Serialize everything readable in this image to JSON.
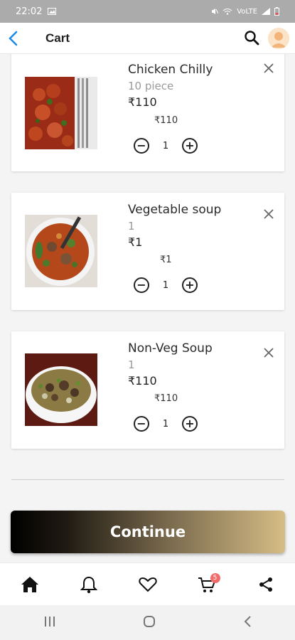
{
  "status_bar": {
    "time": "22:02",
    "network": "VoLTE",
    "signal": "signal-icon",
    "battery": "battery-icon"
  },
  "app_bar": {
    "title": "Cart",
    "back_icon": "back-arrow-icon",
    "search_icon": "search-icon",
    "avatar": "avatar"
  },
  "cart": {
    "items": [
      {
        "name": "Chicken Chilly",
        "quantity_label": "10 piece",
        "price": "₹110",
        "subtotal": "₹110",
        "quantity": "1"
      },
      {
        "name": "Vegetable soup",
        "quantity_label": "1",
        "price": "₹1",
        "subtotal": "₹1",
        "quantity": "1"
      },
      {
        "name": "Non-Veg Soup",
        "quantity_label": "1",
        "price": "₹110",
        "subtotal": "₹110",
        "quantity": "1"
      }
    ]
  },
  "continue_label": "Continue",
  "bottom_nav": {
    "items": [
      "home-icon",
      "bell-icon",
      "heart-icon",
      "cart-icon",
      "share-icon"
    ],
    "cart_badge": "5"
  },
  "system_nav": [
    "recents-icon",
    "home-circle-icon",
    "back-chevron-icon"
  ],
  "colors": {
    "accent": "#1e88e5",
    "badge": "#f26b6b",
    "button_start": "#000000",
    "button_end": "#d6bd86"
  }
}
